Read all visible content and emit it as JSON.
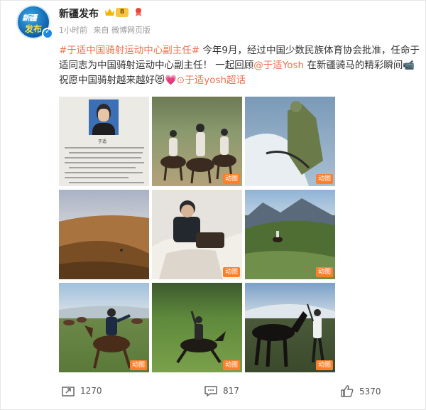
{
  "account": {
    "name": "新疆发布",
    "level": "8",
    "avatar_line1": "新疆",
    "avatar_line2": "发布"
  },
  "meta": {
    "time": "1小时前",
    "source": "来自 微博网页版"
  },
  "post": {
    "topic": "#于适中国骑射运动中心副主任#",
    "text1": " 今年9月，经过中国少数民族体育协会批准，任命于适同志为中国骑射运动中心副主任！ 一起回顾",
    "mention": "@于适Yosh",
    "text2": " 在新疆骑马的精彩瞬间",
    "emoji1": "📹",
    "text3": "祝愿中国骑射越来越好",
    "emoji2": "😻💗",
    "supertopic": "于适yosh超话"
  },
  "gallery": {
    "gif_label": "动图",
    "doc_name": "于适"
  },
  "actions": {
    "repost": "1270",
    "comment": "817",
    "like": "5370"
  },
  "colors": {
    "link": "#eb7350",
    "verified": "#1e88e5",
    "gif_badge": "#ff7f2a"
  }
}
